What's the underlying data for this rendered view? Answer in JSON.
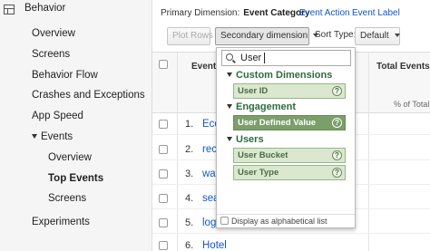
{
  "sidebar": {
    "title": "Behavior",
    "items": [
      {
        "label": "Overview"
      },
      {
        "label": "Screens"
      },
      {
        "label": "Behavior Flow"
      },
      {
        "label": "Crashes and Exceptions"
      },
      {
        "label": "App Speed"
      },
      {
        "label": "Events"
      }
    ],
    "sub_items": [
      {
        "label": "Overview"
      },
      {
        "label": "Top Events"
      },
      {
        "label": "Screens"
      }
    ],
    "bottom_item": "Experiments"
  },
  "primary_dimension": {
    "label": "Primary Dimension:",
    "current": "Event Category",
    "options": [
      "Event Action",
      "Event Label"
    ]
  },
  "toolbar": {
    "plot_rows": "Plot Rows",
    "secondary_dimension": "Secondary dimension",
    "sort_type_label": "Sort Type:",
    "sort_type_value": "Default"
  },
  "table": {
    "header_event": "Event C",
    "header_total": "Total Events",
    "header_pct": "% of Total",
    "rows": [
      {
        "num": "1.",
        "value": "Eco"
      },
      {
        "num": "2.",
        "value": "rec"
      },
      {
        "num": "3.",
        "value": "wal"
      },
      {
        "num": "4.",
        "value": "sea"
      },
      {
        "num": "5.",
        "value": "logi"
      },
      {
        "num": "6.",
        "value": "Hotel"
      }
    ]
  },
  "dropdown": {
    "search_value": "User",
    "groups": [
      {
        "name": "Custom Dimensions",
        "items": [
          "User ID"
        ]
      },
      {
        "name": "Engagement",
        "items": [
          "User Defined Value"
        ]
      },
      {
        "name": "Users",
        "items": [
          "User Bucket",
          "User Type"
        ]
      }
    ],
    "alphabetical_label": "Display as alphabetical list",
    "help_glyph": "?"
  },
  "colors": {
    "group_heading": "#2e6b40",
    "item_bg": "#d9e8cf",
    "item_highlight": "#7b9e6b",
    "link": "#1155cc"
  }
}
